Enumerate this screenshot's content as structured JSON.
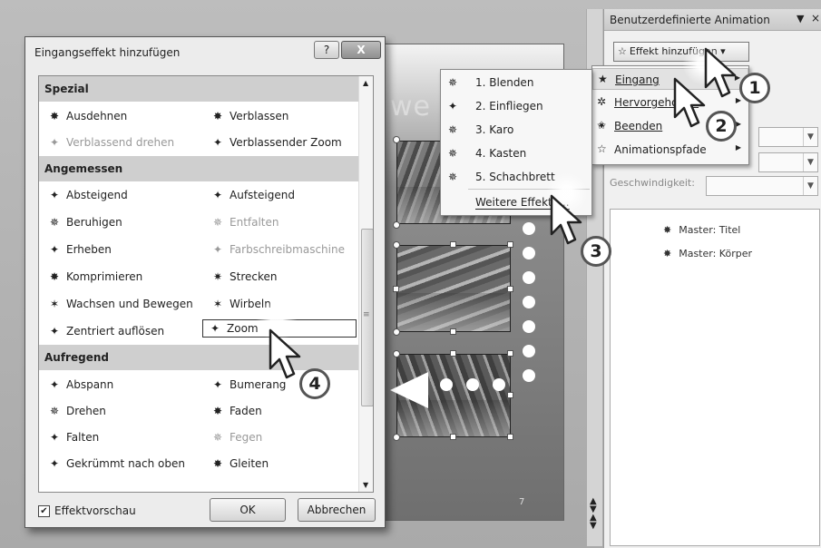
{
  "task_pane": {
    "title": "Benutzerdefinierte Animation",
    "add_effect_label": "Effekt hinzufügen",
    "speed_label": "Geschwindigkeit:",
    "animation_items": [
      "Master: Titel",
      "Master: Körper"
    ]
  },
  "effect_menu": {
    "items": [
      {
        "label": "Eingang",
        "icon": "entrance-star-icon",
        "has_submenu": true,
        "highlighted": true
      },
      {
        "label": "Hervorgehoben",
        "icon": "emphasis-star-icon",
        "has_submenu": true
      },
      {
        "label": "Beenden",
        "icon": "exit-star-icon",
        "has_submenu": true
      },
      {
        "label": "Animationspfade",
        "icon": "path-star-icon",
        "has_submenu": true
      }
    ]
  },
  "entrance_submenu": {
    "items": [
      {
        "label": "1. Blenden",
        "icon": "blinds-icon"
      },
      {
        "label": "2. Einfliegen",
        "icon": "fly-in-icon"
      },
      {
        "label": "3. Karo",
        "icon": "checkerboard-icon"
      },
      {
        "label": "4. Kasten",
        "icon": "box-icon"
      },
      {
        "label": "5. Schachbrett",
        "icon": "chessboard-icon"
      }
    ],
    "more_label": "Weitere Effekte..."
  },
  "slide": {
    "title_fragment": "we",
    "slide_number": "7"
  },
  "dialog": {
    "title": "Eingangseffekt hinzufügen",
    "help_label": "?",
    "close_label": "X",
    "categories": [
      {
        "name": "Spezial",
        "effects": [
          {
            "label": "Ausdehnen",
            "dim": false
          },
          {
            "label": "Verblassen",
            "dim": false
          },
          {
            "label": "Verblassend drehen",
            "dim": true
          },
          {
            "label": "Verblassender Zoom",
            "dim": false
          }
        ]
      },
      {
        "name": "Angemessen",
        "effects": [
          {
            "label": "Absteigend",
            "dim": false
          },
          {
            "label": "Aufsteigend",
            "dim": false
          },
          {
            "label": "Beruhigen",
            "dim": false
          },
          {
            "label": "Entfalten",
            "dim": true
          },
          {
            "label": "Erheben",
            "dim": false
          },
          {
            "label": "Farbschreibmaschine",
            "dim": true
          },
          {
            "label": "Komprimieren",
            "dim": false
          },
          {
            "label": "Strecken",
            "dim": false
          },
          {
            "label": "Wachsen und Bewegen",
            "dim": false
          },
          {
            "label": "Wirbeln",
            "dim": false
          },
          {
            "label": "Zentriert auflösen",
            "dim": false
          },
          {
            "label": "Zoom",
            "dim": false,
            "selected": true
          }
        ]
      },
      {
        "name": "Aufregend",
        "effects": [
          {
            "label": "Abspann",
            "dim": false
          },
          {
            "label": "Bumerang",
            "dim": false
          },
          {
            "label": "Drehen",
            "dim": false
          },
          {
            "label": "Faden",
            "dim": false
          },
          {
            "label": "Falten",
            "dim": false
          },
          {
            "label": "Fegen",
            "dim": true
          },
          {
            "label": "Gekrümmt nach oben",
            "dim": false
          },
          {
            "label": "Gleiten",
            "dim": false
          }
        ]
      }
    ],
    "preview_label": "Effektvorschau",
    "preview_checked": true,
    "ok_label": "OK",
    "cancel_label": "Abbrechen"
  },
  "steps": [
    "1",
    "2",
    "3",
    "4"
  ]
}
